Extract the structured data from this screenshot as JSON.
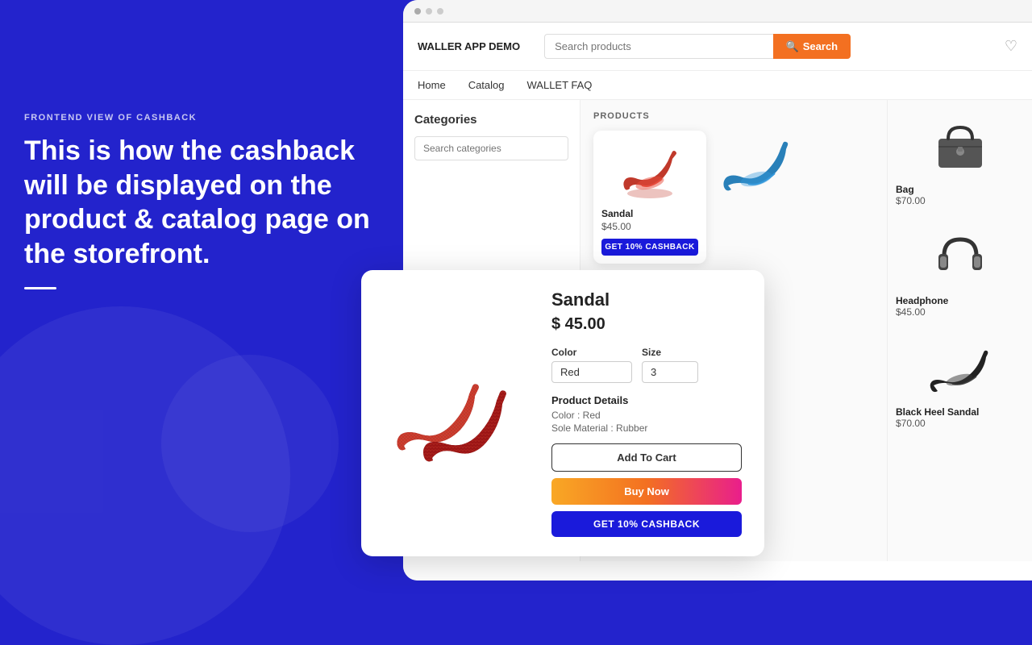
{
  "left": {
    "tagline": "FRONTEND VIEW OF CASHBACK",
    "headline": "This is how the cashback will be displayed on the product & catalog page on the storefront."
  },
  "header": {
    "logo": "WALLER APP DEMO",
    "search_placeholder": "Search products",
    "search_button": "Search",
    "nav": [
      "Home",
      "Catalog",
      "WALLET FAQ"
    ]
  },
  "sidebar": {
    "title": "Categories",
    "search_placeholder": "Search categories"
  },
  "products": {
    "section_label": "PRODUCTS",
    "grid": [
      {
        "name": "Sandal",
        "price": "$45.00",
        "cashback": "GET 10% CASHBACK"
      },
      {
        "name": "Bag",
        "price": "$70.00"
      },
      {
        "name": "Headphone",
        "price": "$45.00"
      },
      {
        "name": "Black Heel Sandal",
        "price": "$70.00"
      }
    ]
  },
  "modal": {
    "title": "Sandal",
    "price": "$ 45.00",
    "color_label": "Color",
    "color_value": "Red",
    "size_label": "Size",
    "size_value": "3",
    "details_title": "Product Details",
    "detail_color": "Color : Red",
    "detail_material": "Sole Material : Rubber",
    "btn_cart": "Add To Cart",
    "btn_buy": "Buy Now",
    "btn_cashback": "GET 10% CASHBACK"
  },
  "browser": {
    "dot1": "#e74c3c",
    "dot2": "#f39c12",
    "dot3": "#2ecc71"
  }
}
